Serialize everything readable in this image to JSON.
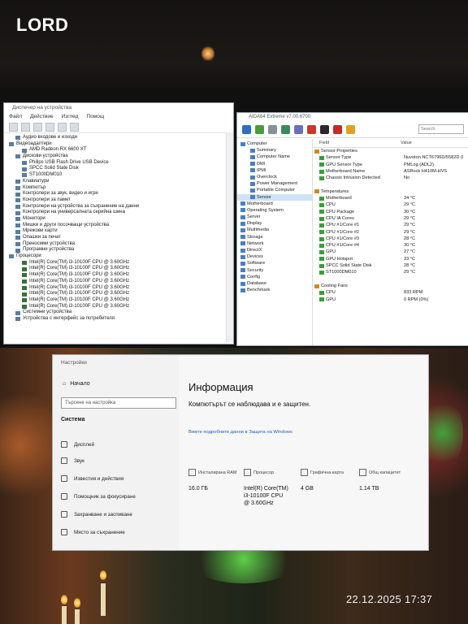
{
  "overlay": {
    "label": "LORD",
    "timestamp": "22.12.2025 17:37"
  },
  "device_manager": {
    "title": "Диспечер на устройства",
    "menu": [
      "Файл",
      "Действие",
      "Изглед",
      "Помощ"
    ],
    "tree": [
      {
        "text": "Аудио входове и изходи",
        "indent": 1
      },
      {
        "text": "Видеоадаптери",
        "indent": 0
      },
      {
        "text": "AMD Radeon RX 6600 XT",
        "indent": 2
      },
      {
        "text": "Дискови устройства",
        "indent": 1
      },
      {
        "text": "Philips USB Flash Drive USB Device",
        "indent": 2
      },
      {
        "text": "SPCC Solid State Disk",
        "indent": 2
      },
      {
        "text": "ST1000DM010",
        "indent": 2
      },
      {
        "text": "Клавиатури",
        "indent": 1
      },
      {
        "text": "Компютър",
        "indent": 1
      },
      {
        "text": "Контролери за звук, видео и игри",
        "indent": 1
      },
      {
        "text": "Контролери за памет",
        "indent": 1
      },
      {
        "text": "Контролери на устройства за съхранение на данни",
        "indent": 1
      },
      {
        "text": "Контролери на универсалната серийна шина",
        "indent": 1
      },
      {
        "text": "Монитори",
        "indent": 1
      },
      {
        "text": "Мишки и други посочващи устройства",
        "indent": 1
      },
      {
        "text": "Мрежови карти",
        "indent": 1
      },
      {
        "text": "Опашки за печат",
        "indent": 1
      },
      {
        "text": "Преносими устройства",
        "indent": 1
      },
      {
        "text": "Програмни устройства",
        "indent": 1
      },
      {
        "text": "Процесори",
        "indent": 0
      },
      {
        "text": "Intel(R) Core(TM) i3-10100F CPU @ 3.60GHz",
        "indent": 2,
        "cpu": true
      },
      {
        "text": "Intel(R) Core(TM) i3-10100F CPU @ 3.60GHz",
        "indent": 2,
        "cpu": true
      },
      {
        "text": "Intel(R) Core(TM) i3-10100F CPU @ 3.60GHz",
        "indent": 2,
        "cpu": true
      },
      {
        "text": "Intel(R) Core(TM) i3-10100F CPU @ 3.60GHz",
        "indent": 2,
        "cpu": true
      },
      {
        "text": "Intel(R) Core(TM) i3-10100F CPU @ 3.60GHz",
        "indent": 2,
        "cpu": true
      },
      {
        "text": "Intel(R) Core(TM) i3-10100F CPU @ 3.60GHz",
        "indent": 2,
        "cpu": true
      },
      {
        "text": "Intel(R) Core(TM) i3-10100F CPU @ 3.60GHz",
        "indent": 2,
        "cpu": true
      },
      {
        "text": "Intel(R) Core(TM) i3-10100F CPU @ 3.60GHz",
        "indent": 2,
        "cpu": true
      },
      {
        "text": "Системни устройства",
        "indent": 1
      },
      {
        "text": "Устройства с интерфейс за потребителя",
        "indent": 1
      }
    ]
  },
  "aida": {
    "title": "AIDA64 Extreme v7.00.6700",
    "search_placeholder": "Search",
    "nav": [
      {
        "text": "Computer",
        "indent": 0
      },
      {
        "text": "Summary",
        "indent": 2
      },
      {
        "text": "Computer Name",
        "indent": 2
      },
      {
        "text": "DMI",
        "indent": 2
      },
      {
        "text": "IPMI",
        "indent": 2
      },
      {
        "text": "Overclock",
        "indent": 2
      },
      {
        "text": "Power Management",
        "indent": 2
      },
      {
        "text": "Portable Computer",
        "indent": 2
      },
      {
        "text": "Sensor",
        "indent": 2,
        "selected": true
      },
      {
        "text": "Motherboard",
        "indent": 0
      },
      {
        "text": "Operating System",
        "indent": 0
      },
      {
        "text": "Server",
        "indent": 0
      },
      {
        "text": "Display",
        "indent": 0
      },
      {
        "text": "Multimedia",
        "indent": 0
      },
      {
        "text": "Storage",
        "indent": 0
      },
      {
        "text": "Network",
        "indent": 0
      },
      {
        "text": "DirectX",
        "indent": 0
      },
      {
        "text": "Devices",
        "indent": 0
      },
      {
        "text": "Software",
        "indent": 0
      },
      {
        "text": "Security",
        "indent": 0
      },
      {
        "text": "Config",
        "indent": 0
      },
      {
        "text": "Database",
        "indent": 0
      },
      {
        "text": "Benchmark",
        "indent": 0
      }
    ],
    "columns": {
      "field": "Field",
      "value": "Value"
    },
    "rows": [
      {
        "field": "Sensor Properties",
        "value": "",
        "section": true
      },
      {
        "field": "Sensor Type",
        "value": "Nuvoton NCT6796D/5582D (I"
      },
      {
        "field": "GPU Sensor Type",
        "value": "PMLog (ADL2)"
      },
      {
        "field": "Motherboard Name",
        "value": "ASRock H410M-HVS"
      },
      {
        "field": "Chassis Intrusion Detected",
        "value": "No"
      },
      {
        "field": "",
        "value": ""
      },
      {
        "field": "Temperatures",
        "value": "",
        "section": true
      },
      {
        "field": "Motherboard",
        "value": "34 °C"
      },
      {
        "field": "CPU",
        "value": "29 °C"
      },
      {
        "field": "CPU Package",
        "value": "30 °C"
      },
      {
        "field": "CPU IA Cores",
        "value": "29 °C"
      },
      {
        "field": "CPU #1/Core #1",
        "value": "29 °C"
      },
      {
        "field": "CPU #1/Core #2",
        "value": "29 °C"
      },
      {
        "field": "CPU #1/Core #3",
        "value": "28 °C"
      },
      {
        "field": "CPU #1/Core #4",
        "value": "30 °C"
      },
      {
        "field": "GPU",
        "value": "27 °C"
      },
      {
        "field": "GPU Hotspot",
        "value": "33 °C"
      },
      {
        "field": "SPCC Solid State Disk",
        "value": "28 °C"
      },
      {
        "field": "ST1000DM010",
        "value": "29 °C"
      },
      {
        "field": "",
        "value": ""
      },
      {
        "field": "Cooling Fans",
        "value": "",
        "section": true
      },
      {
        "field": "CPU",
        "value": "833 RPM"
      },
      {
        "field": "GPU",
        "value": "0 RPM (0%)"
      }
    ]
  },
  "settings": {
    "window_title": "Настройки",
    "home": "Начало",
    "search_placeholder": "Търсене на настройка",
    "section": "Система",
    "nav": [
      "Дисплей",
      "Звук",
      "Известия и действия",
      "Помощник за фокусиране",
      "Захранване и заспиване",
      "Място за съхранение"
    ],
    "heading": "Информация",
    "protection": "Компютърът се наблюдава и е защитен.",
    "details_link": "Вижте подробните данни в Защита на Windows",
    "cards": [
      {
        "label": "Инсталирана RAM",
        "value": "16.0 ГБ"
      },
      {
        "label": "Процесор",
        "value": "Intel(R) Core(TM) i3-10100F CPU @ 3.60GHz"
      },
      {
        "label": "Графична карта",
        "value": "4 GB"
      },
      {
        "label": "Общ капацитет",
        "value": "1.14 TB"
      }
    ]
  }
}
